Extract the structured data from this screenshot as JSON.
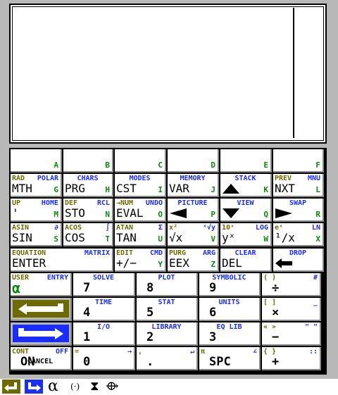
{
  "menu_letters": [
    "A",
    "B",
    "C",
    "D",
    "E",
    "F"
  ],
  "rows": [
    [
      {
        "main": "MTH",
        "left": "RAD",
        "right": "POLAR",
        "letter": "G"
      },
      {
        "main": "PRG",
        "center": "CHARS",
        "letter": "H"
      },
      {
        "main": "CST",
        "center": "MODES",
        "letter": "I"
      },
      {
        "main": "VAR",
        "center": "MEMORY",
        "letter": "J"
      },
      {
        "icon": "up-triangle-icon",
        "center": "STACK",
        "letter": "K"
      },
      {
        "main": "NXT",
        "left": "PREV",
        "right": "MNU",
        "letter": "L"
      }
    ],
    [
      {
        "main": "'",
        "left": "UP",
        "right": "HOME",
        "letter": "M"
      },
      {
        "main": "STO",
        "left": "DEF",
        "right": "RCL",
        "letter": "N"
      },
      {
        "main": "EVAL",
        "left": "→NUM",
        "right": "UNDO",
        "letter": "O"
      },
      {
        "icon": "left-triangle-icon",
        "center": "PICTURE",
        "letter": "P"
      },
      {
        "icon": "down-triangle-icon",
        "center": "VIEW",
        "letter": "Q"
      },
      {
        "icon": "right-triangle-icon",
        "center": "SWAP",
        "letter": "R"
      }
    ],
    [
      {
        "main": "SIN",
        "left": "ASIN",
        "right": "∂",
        "letter": "S"
      },
      {
        "main": "COS",
        "left": "ACOS",
        "right": "∫",
        "letter": "T"
      },
      {
        "main": "TAN",
        "left": "ATAN",
        "right": "Σ",
        "letter": "U"
      },
      {
        "main": "√x",
        "left": "x²",
        "right": "ˣ√y",
        "letter": "V"
      },
      {
        "main": "yˣ",
        "left": "10ˣ",
        "right": "LOG",
        "letter": "W"
      },
      {
        "main": "¹/x",
        "left": "eˣ",
        "right": "LN",
        "letter": "X"
      }
    ]
  ],
  "row4": [
    {
      "main": "ENTER",
      "left": "EQUATION",
      "right": "MATRIX"
    },
    {
      "main": "+∕−",
      "left": "EDIT",
      "right": "CMD",
      "letter": "Y"
    },
    {
      "main": "EEX",
      "left": "PURG",
      "right": "ARG",
      "letter": "Z"
    },
    {
      "main": "DEL",
      "center": "CLEAR"
    },
    {
      "icon": "backspace-arrow-icon",
      "center": "DROP"
    }
  ],
  "numpad": [
    [
      {
        "main": "α",
        "left": "USER",
        "right": "ENTRY",
        "kind": "alpha"
      },
      {
        "main": "7",
        "center": "SOLVE"
      },
      {
        "main": "8",
        "center": "PLOT"
      },
      {
        "main": "9",
        "center": "SYMBOLIC"
      },
      {
        "main": "÷",
        "left": "( )",
        "right": "#"
      }
    ],
    [
      {
        "kind": "left-shift"
      },
      {
        "main": "4",
        "center": "TIME"
      },
      {
        "main": "5",
        "center": "STAT"
      },
      {
        "main": "6",
        "center": "UNITS"
      },
      {
        "main": "×",
        "left": "[ ]",
        "right": "_"
      }
    ],
    [
      {
        "kind": "right-shift"
      },
      {
        "main": "1",
        "center": "I/O"
      },
      {
        "main": "2",
        "center": "LIBRARY"
      },
      {
        "main": "3",
        "center": "EQ LIB"
      },
      {
        "main": "−",
        "left": "« »",
        "right": "\" \""
      }
    ],
    [
      {
        "main": "ON",
        "sub": "CANCEL",
        "left": "CONT",
        "right": "OFF"
      },
      {
        "main": "0",
        "left": "=",
        "right": "→"
      },
      {
        "main": ".",
        "left": ",",
        "right": "↵"
      },
      {
        "main": "SPC",
        "left": "π",
        "right": "∠"
      },
      {
        "main": "+",
        "left": "{ }",
        "right": "::"
      }
    ]
  ],
  "status_icons": [
    "left-shift-indicator-icon",
    "right-shift-indicator-icon",
    "alpha-indicator-icon",
    "transmit-indicator-icon",
    "busy-hourglass-icon",
    "io-arrow-icon"
  ],
  "status_glyphs": {
    "alpha": "α",
    "transmit": "(·)",
    "busy": "⧗",
    "io": "⟴"
  },
  "colors": {
    "body": "#b8b8b8",
    "shift_left": "#6b6b00",
    "shift_right": "#1a2cff",
    "alpha_letter": "#0a8a0a"
  }
}
